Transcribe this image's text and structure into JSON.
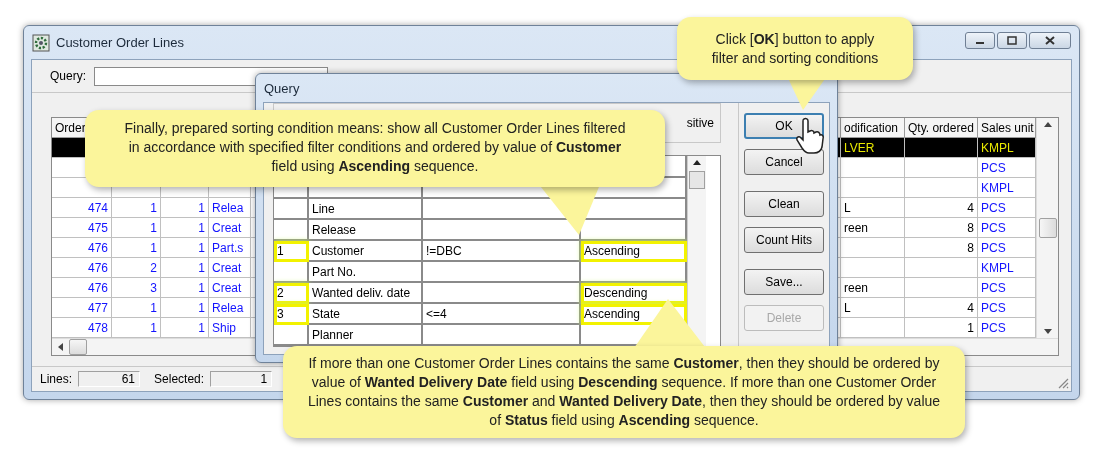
{
  "window": {
    "title": "Customer Order Lines"
  },
  "query": {
    "label": "Query:"
  },
  "table": {
    "header": {
      "column_1": "Order",
      "column_6": "odification",
      "column_7": "Qty. ordered",
      "column_8": "Sales unit"
    },
    "rows": [
      {
        "selected": true,
        "column_6": "LVER",
        "column_8": "KMPL"
      },
      {
        "selected": false,
        "column_8": "PCS"
      },
      {
        "selected": false,
        "column_8": "KMPL"
      },
      {
        "selected": false,
        "column_1": "474",
        "column_2": "1",
        "column_3": "1",
        "column_4": "Relea",
        "column_6": "L",
        "column_7": "4",
        "column_8": "PCS"
      },
      {
        "selected": false,
        "column_1": "475",
        "column_2": "1",
        "column_3": "1",
        "column_4": "Creat",
        "column_6": "reen",
        "column_7": "8",
        "column_8": "PCS"
      },
      {
        "selected": false,
        "column_1": "476",
        "column_2": "1",
        "column_3": "1",
        "column_4": "Part.s",
        "column_7": "8",
        "column_8": "PCS"
      },
      {
        "selected": false,
        "column_1": "476",
        "column_2": "2",
        "column_3": "1",
        "column_4": "Creat",
        "column_8": "KMPL"
      },
      {
        "selected": false,
        "column_1": "476",
        "column_2": "3",
        "column_3": "1",
        "column_4": "Creat",
        "column_6": "reen",
        "column_8": "PCS"
      },
      {
        "selected": false,
        "column_1": "477",
        "column_2": "1",
        "column_3": "1",
        "column_4": "Relea",
        "column_6": "L",
        "column_7": "4",
        "column_8": "PCS"
      },
      {
        "selected": false,
        "column_1": "478",
        "column_2": "1",
        "column_3": "1",
        "column_4": "Ship",
        "column_7": "1",
        "column_8": "PCS"
      }
    ]
  },
  "status_bar": {
    "lines_label": "Lines:",
    "lines": "61",
    "selected_label": "Selected:",
    "selected": "1"
  },
  "dialog": {
    "title": "Query",
    "option_label": "sitive",
    "rows": [
      {
        "field": "Line",
        "highlighted": false
      },
      {
        "field": "Release",
        "highlighted": false
      },
      {
        "sort_order": "1",
        "field": "Customer",
        "value": "!=DBC",
        "sort": "Ascending",
        "highlighted": true
      },
      {
        "field": "Part No.",
        "highlighted": false
      },
      {
        "sort_order": "2",
        "field": "Wanted deliv. date",
        "sort": "Descending",
        "highlighted": true
      },
      {
        "sort_order": "3",
        "field": "State",
        "value": "<=4",
        "sort": "Ascending",
        "highlighted": true
      },
      {
        "field": "Planner",
        "highlighted": false
      }
    ],
    "buttons": [
      {
        "label": "OK",
        "disabled": false
      },
      {
        "label": "Cancel",
        "disabled": false
      },
      {
        "label": "Clean",
        "disabled": false
      },
      {
        "label": "Count Hits",
        "disabled": false
      },
      {
        "label": "Save...",
        "disabled": false
      },
      {
        "label": "Delete",
        "disabled": true
      }
    ]
  },
  "callouts": [
    {
      "text": "Click [**OK**] button to apply filter and sorting conditions"
    },
    {
      "text": "Finally, prepared sorting condition means: show all Customer Order Lines filtered in accordance with specified filter conditions and ordered by value of **Customer** field using **Ascending** sequence."
    },
    {
      "text": "If more than one Customer Order Lines contains the same **Customer**, then they should be ordered by value of **Wanted Delivery Date** field using **Descending** sequence.  If more than one Customer Order Lines contains the same **Customer** and **Wanted Delivery Date**, then they should be ordered by value of **Status** field using **Ascending** sequence."
    }
  ]
}
